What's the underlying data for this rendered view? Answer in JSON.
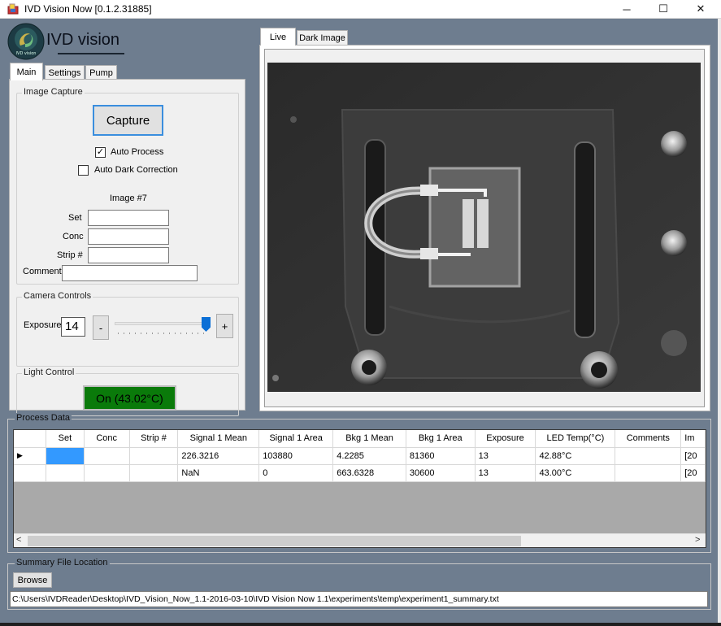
{
  "window": {
    "title": "IVD Vision Now [0.1.2.31885]",
    "minimize": "─",
    "maximize": "☐",
    "close": "✕"
  },
  "logo": {
    "text": "IVD vision",
    "badge": "IVD vision"
  },
  "left_tabs": [
    {
      "label": "Main"
    },
    {
      "label": "Settings"
    },
    {
      "label": "Pump"
    }
  ],
  "image_capture": {
    "title": "Image Capture",
    "capture_label": "Capture",
    "auto_process": {
      "label": "Auto Process",
      "checked": true
    },
    "auto_dark": {
      "label": "Auto Dark Correction",
      "checked": false
    },
    "image_number": "Image #7",
    "set_label": "Set",
    "set_value": "",
    "conc_label": "Conc",
    "conc_value": "",
    "strip_label": "Strip #",
    "strip_value": "",
    "comment_label": "Comment",
    "comment_value": ""
  },
  "camera_controls": {
    "title": "Camera Controls",
    "exposure_label": "Exposure",
    "exposure_value": "14",
    "minus": "-",
    "plus": "+",
    "slider_level": 0.95
  },
  "light_control": {
    "title": "Light Control",
    "status": "On (43.02°C)",
    "status_color": "#0a7a0a"
  },
  "right_tabs": [
    {
      "label": "Live"
    },
    {
      "label": "Dark Image"
    }
  ],
  "process_data": {
    "title": "Process Data",
    "columns": [
      "",
      "Set",
      "Conc",
      "Strip #",
      "Signal 1 Mean",
      "Signal 1 Area",
      "Bkg 1 Mean",
      "Bkg 1 Area",
      "Exposure",
      "LED Temp(°C)",
      "Comments",
      "Im"
    ],
    "rows": [
      [
        "▶",
        "",
        "",
        "",
        "226.3216",
        "103880",
        "4.2285",
        "81360",
        "13",
        "42.88°C",
        "",
        "[20"
      ],
      [
        "",
        "",
        "",
        "",
        "NaN",
        "0",
        "663.6328",
        "30600",
        "13",
        "43.00°C",
        "",
        "[20"
      ]
    ],
    "scroll_left": "<",
    "scroll_right": ">"
  },
  "summary": {
    "title": "Summary File Location",
    "browse_label": "Browse",
    "path": "C:\\Users\\IVDReader\\Desktop\\IVD_Vision_Now_1.1-2016-03-10\\IVD Vision Now 1.1\\experiments\\temp\\experiment1_summary.txt"
  },
  "colors": {
    "background": "#6e7d8f",
    "selected_cell": "#3399ff",
    "light_on": "#0a7a0a"
  }
}
